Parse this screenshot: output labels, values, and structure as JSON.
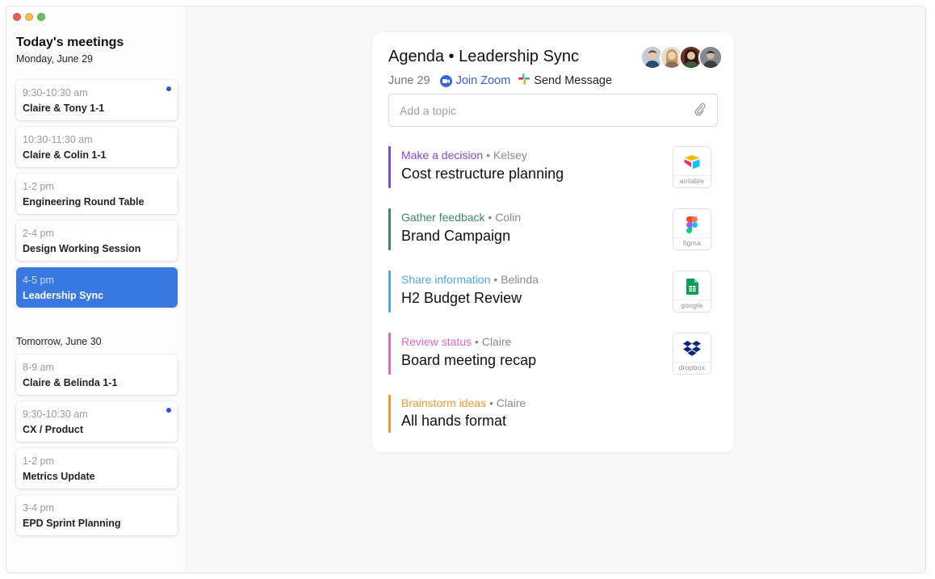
{
  "sidebar": {
    "title": "Today's meetings",
    "today_date": "Monday, June 29",
    "today_meetings": [
      {
        "time": "9:30-10:30 am",
        "name": "Claire & Tony 1-1",
        "unread": true,
        "active": false
      },
      {
        "time": "10:30-11:30 am",
        "name": "Claire & Colin 1-1",
        "unread": false,
        "active": false
      },
      {
        "time": "1-2 pm",
        "name": "Engineering Round Table",
        "unread": false,
        "active": false
      },
      {
        "time": "2-4 pm",
        "name": "Design Working Session",
        "unread": false,
        "active": false
      },
      {
        "time": "4-5 pm",
        "name": "Leadership Sync",
        "unread": false,
        "active": true
      }
    ],
    "tomorrow_date": "Tomorrow, June 30",
    "tomorrow_meetings": [
      {
        "time": "8-9 am",
        "name": "Claire & Belinda 1-1",
        "unread": false,
        "active": false
      },
      {
        "time": "9:30-10:30 am",
        "name": "CX / Product",
        "unread": true,
        "active": false
      },
      {
        "time": "1-2 pm",
        "name": "Metrics Update",
        "unread": false,
        "active": false
      },
      {
        "time": "3-4 pm",
        "name": "EPD Sprint Planning",
        "unread": false,
        "active": false
      }
    ]
  },
  "agenda": {
    "title": "Agenda • Leadership Sync",
    "date": "June 29",
    "join_zoom": "Join Zoom",
    "send_message": "Send Message",
    "topic_placeholder": "Add a topic",
    "items": [
      {
        "category": "Make a decision",
        "owner": "• Kelsey",
        "topic": "Cost restructure planning",
        "color": "#8b45d6",
        "app": "airtable"
      },
      {
        "category": "Gather feedback",
        "owner": "• Colin",
        "topic": "Brand Campaign",
        "color": "#3d8a66",
        "app": "figma"
      },
      {
        "category": "Share information",
        "owner": "• Belinda",
        "topic": "H2 Budget Review",
        "color": "#4da8e8",
        "app": "google"
      },
      {
        "category": "Review status",
        "owner": "• Claire",
        "topic": "Board meeting recap",
        "color": "#e566c6",
        "app": "dropbox"
      },
      {
        "category": "Brainstorm ideas",
        "owner": "• Claire",
        "topic": "All hands format",
        "color": "#eb9a32",
        "app": ""
      }
    ]
  },
  "colors": {
    "accent": "#3878e0",
    "unread_dot": "#3450d9",
    "zoom": "#3a5bd9"
  }
}
